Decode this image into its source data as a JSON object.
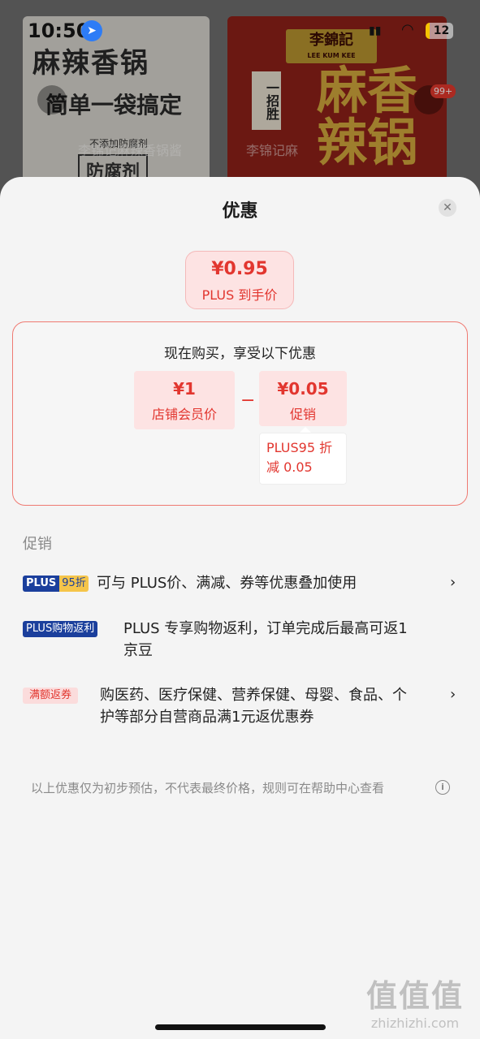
{
  "status_bar": {
    "time": "10:50",
    "location_icon": "location-arrow-icon",
    "battery": "12"
  },
  "background": {
    "left_title": "麻辣香锅",
    "left_sub": "简单一袋搞定",
    "left_note": "不添加防腐剂",
    "left_box": "防腐剂",
    "brand": "李錦記",
    "brand_en": "LEE KUM KEE",
    "right_title": "麻香辣锅",
    "right_badge": "一招胜",
    "badge_count": "99+",
    "tab_left": "李锦记麻辣香锅酱",
    "tab_right": "李锦记麻"
  },
  "sheet": {
    "title": "优惠",
    "close_icon": "close-icon"
  },
  "price": {
    "amount": "¥0.95",
    "label": "PLUS 到手价"
  },
  "breakdown": {
    "heading": "现在购买，享受以下优惠",
    "member": {
      "amount": "¥1",
      "label": "店铺会员价"
    },
    "minus": "−",
    "promo": {
      "amount": "¥0.05",
      "label": "促销"
    },
    "promo_detail_line1": "PLUS95 折",
    "promo_detail_line2": "减 0.05"
  },
  "promotions": {
    "section_title": "促销",
    "items": [
      {
        "tag_plus": "PLUS",
        "tag_discount": "95折",
        "text": "可与 PLUS价、满减、券等优惠叠加使用"
      },
      {
        "tag": "PLUS购物返利",
        "text_line1": "PLUS 专享购物返利，订单完成后最高可返1",
        "text_line2": "京豆"
      },
      {
        "tag": "满额返券",
        "text_line1": "购医药、医疗保健、营养保健、母婴、食品、个",
        "text_line2": "护等部分自营商品满1元返优惠券"
      }
    ]
  },
  "disclaimer": "以上优惠仅为初步预估，不代表最终价格，规则可在帮助中心查看",
  "watermark": {
    "logo": "值值值",
    "url": "zhizhizhi.com"
  },
  "colors": {
    "accent_red": "#e2362f",
    "plus_blue": "#1b3f9c",
    "plus_gold": "#f5c54a"
  }
}
